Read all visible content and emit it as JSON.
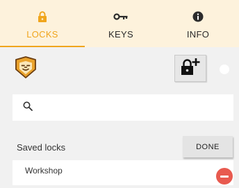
{
  "tabs": [
    {
      "label": "LOCKS",
      "icon": "lock-icon",
      "active": true
    },
    {
      "label": "KEYS",
      "icon": "key-icon",
      "active": false
    },
    {
      "label": "INFO",
      "icon": "info-icon",
      "active": false
    }
  ],
  "colors": {
    "accent": "#f0a51c",
    "tabbar_bg": "#fdf2dc",
    "page_bg": "#f1f1f1",
    "remove": "#e85a4f"
  },
  "toolbar": {
    "logo_icon": "lion-icon",
    "add_lock_icon": "add-lock-icon"
  },
  "search": {
    "icon": "search-icon",
    "value": "",
    "placeholder": ""
  },
  "saved_locks": {
    "title": "Saved locks",
    "done_label": "DONE",
    "items": [
      {
        "name": "Workshop",
        "action_icon": "remove-icon"
      }
    ]
  }
}
